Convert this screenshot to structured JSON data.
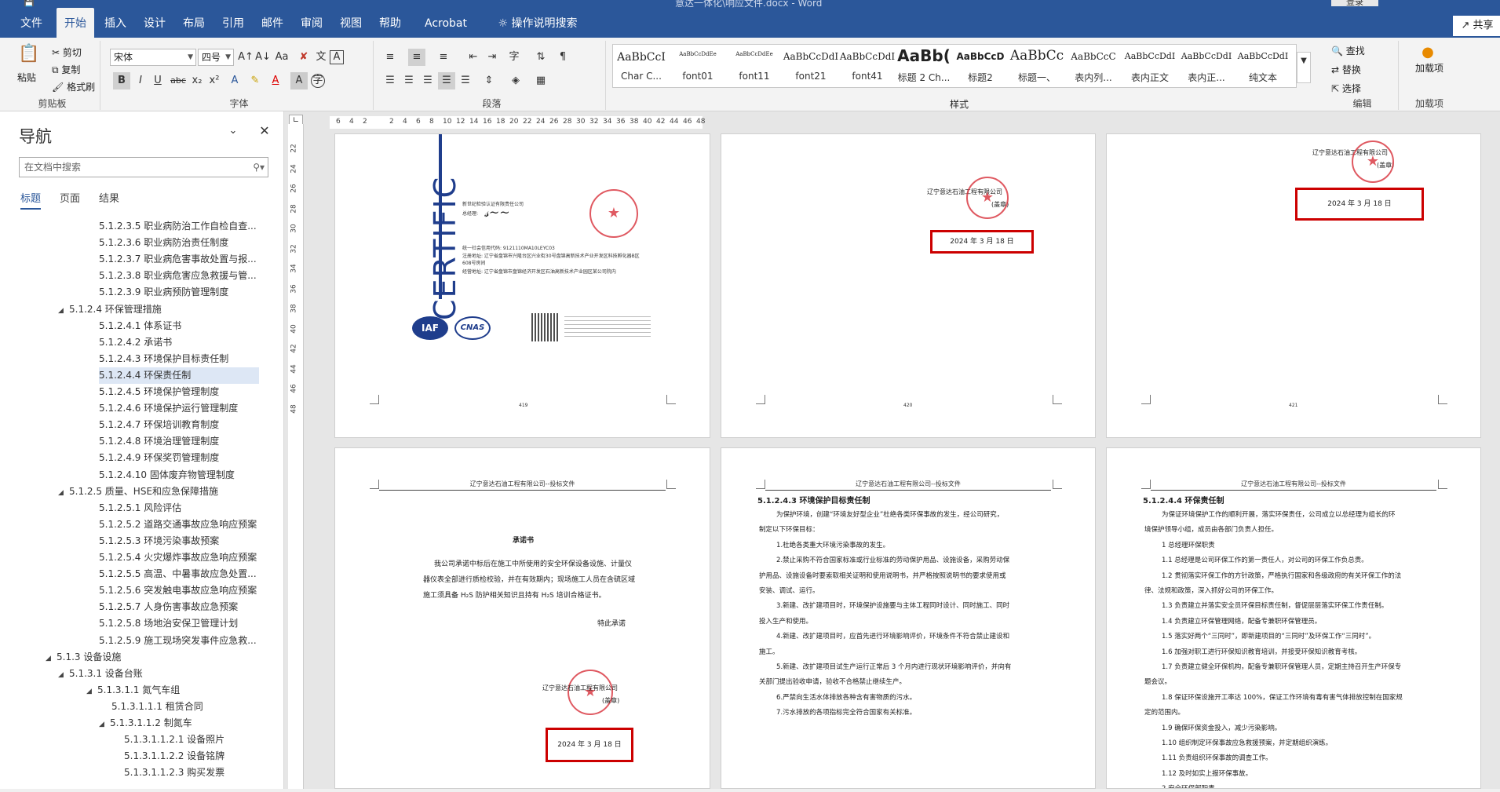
{
  "titlebar": {
    "document_title": "意达一体化\\响应文件.docx  -  Word",
    "login": "登录"
  },
  "menu": {
    "tabs": [
      "文件",
      "开始",
      "插入",
      "设计",
      "布局",
      "引用",
      "邮件",
      "审阅",
      "视图",
      "帮助",
      "Acrobat"
    ],
    "tellme": "操作说明搜索",
    "share": "共享"
  },
  "ribbon": {
    "clipboard": {
      "paste": "粘贴",
      "cut": "剪切",
      "copy": "复制",
      "format_painter": "格式刷",
      "label": "剪贴板"
    },
    "font": {
      "family": "宋体",
      "size": "四号",
      "label": "字体"
    },
    "paragraph": {
      "label": "段落"
    },
    "styles": {
      "label": "样式",
      "items": [
        {
          "preview": "AaBbCcI",
          "name": "Char C..."
        },
        {
          "preview": "AaBbCcDdEe",
          "name": "font01"
        },
        {
          "preview": "AaBbCcDdEe",
          "name": "font11"
        },
        {
          "preview": "AaBbCcDdI",
          "name": "font21"
        },
        {
          "preview": "AaBbCcDdI",
          "name": "font41"
        },
        {
          "preview": "AaBb(",
          "name": "标题 2 Ch..."
        },
        {
          "preview": "AaBbCcD",
          "name": "标题2"
        },
        {
          "preview": "AaBbCc",
          "name": "标题一、"
        },
        {
          "preview": "AaBbCcC",
          "name": "表内列..."
        },
        {
          "preview": "AaBbCcDdI",
          "name": "表内正文"
        },
        {
          "preview": "AaBbCcDdI",
          "name": "表内正..."
        },
        {
          "preview": "AaBbCcDdI",
          "name": "纯文本"
        }
      ]
    },
    "editing": {
      "find": "查找",
      "replace": "替换",
      "select": "选择",
      "label": "编辑"
    },
    "addins": {
      "load": "加载项",
      "label": "加载项"
    }
  },
  "nav": {
    "title": "导航",
    "search_placeholder": "在文档中搜索",
    "tabs": [
      "标题",
      "页面",
      "结果"
    ],
    "items": [
      {
        "level": 3,
        "text": "5.1.2.3.5 职业病防治工作自检自查..."
      },
      {
        "level": 3,
        "text": "5.1.2.3.6 职业病防治责任制度"
      },
      {
        "level": 3,
        "text": "5.1.2.3.7 职业病危害事故处置与报..."
      },
      {
        "level": 3,
        "text": "5.1.2.3.8 职业病危害应急救援与管..."
      },
      {
        "level": 3,
        "text": "5.1.2.3.9 职业病预防管理制度"
      },
      {
        "level": 2,
        "text": "5.1.2.4 环保管理措施",
        "expanded": true
      },
      {
        "level": 3,
        "text": "5.1.2.4.1 体系证书"
      },
      {
        "level": 3,
        "text": "5.1.2.4.2 承诺书"
      },
      {
        "level": 3,
        "text": "5.1.2.4.3 环境保护目标责任制"
      },
      {
        "level": 3,
        "text": "5.1.2.4.4 环保责任制",
        "selected": true
      },
      {
        "level": 3,
        "text": "5.1.2.4.5 环境保护管理制度"
      },
      {
        "level": 3,
        "text": "5.1.2.4.6 环境保护运行管理制度"
      },
      {
        "level": 3,
        "text": "5.1.2.4.7 环保培训教育制度"
      },
      {
        "level": 3,
        "text": "5.1.2.4.8 环境治理管理制度"
      },
      {
        "level": 3,
        "text": "5.1.2.4.9 环保奖罚管理制度"
      },
      {
        "level": 3,
        "text": "5.1.2.4.10 固体废弃物管理制度"
      },
      {
        "level": 2,
        "text": "5.1.2.5 质量、HSE和应急保障措施",
        "expanded": true
      },
      {
        "level": 3,
        "text": "5.1.2.5.1 风险评估"
      },
      {
        "level": 3,
        "text": "5.1.2.5.2 道路交通事故应急响应预案"
      },
      {
        "level": 3,
        "text": "5.1.2.5.3 环境污染事故预案"
      },
      {
        "level": 3,
        "text": "5.1.2.5.4 火灾爆炸事故应急响应预案"
      },
      {
        "level": 3,
        "text": "5.1.2.5.5 高温、中暑事故应急处置..."
      },
      {
        "level": 3,
        "text": "5.1.2.5.6 突发触电事故应急响应预案"
      },
      {
        "level": 3,
        "text": "5.1.2.5.7 人身伤害事故应急预案"
      },
      {
        "level": 3,
        "text": "5.1.2.5.8 场地治安保卫管理计划"
      },
      {
        "level": 3,
        "text": "5.1.2.5.9 施工现场突发事件应急救..."
      },
      {
        "level": 1,
        "text": "5.1.3 设备设施",
        "expanded": true
      },
      {
        "level": 2,
        "text": "5.1.3.1 设备台账",
        "expanded": true
      },
      {
        "level": 3,
        "text": "5.1.3.1.1 氮气车组",
        "expanded": true
      },
      {
        "level": 4,
        "text": "5.1.3.1.1.1 租赁合同"
      },
      {
        "level": 4,
        "text": "5.1.3.1.1.2 制氮车",
        "expanded": true
      },
      {
        "level": 5,
        "text": "5.1.3.1.1.2.1 设备照片"
      },
      {
        "level": 5,
        "text": "5.1.3.1.1.2.2 设备铭牌"
      },
      {
        "level": 5,
        "text": "5.1.3.1.1.2.3 购买发票"
      }
    ]
  },
  "ruler": {
    "h_ticks": [
      "6",
      "4",
      "2",
      "",
      "2",
      "4",
      "6",
      "8",
      "10",
      "12",
      "14",
      "16",
      "18",
      "20",
      "22",
      "24",
      "26",
      "28",
      "30",
      "32",
      "34",
      "36",
      "38",
      "40",
      "42",
      "44",
      "46",
      "48"
    ],
    "v_ticks": [
      "22",
      "24",
      "26",
      "28",
      "30",
      "32",
      "34",
      "36",
      "38",
      "40",
      "42",
      "44",
      "46",
      "48"
    ]
  },
  "pages": {
    "p1": {
      "cert_word": "CERTIFIC",
      "org": "新世纪检验认证有限责任公司",
      "gm": "总经理:",
      "lines": [
        "统一社会信用代码: 9121110MA10LEYC03",
        "注册地址: 辽宁省盘锦市兴隆台区兴业街30号盘锦高新技术产业开发区科技孵化器B区608号房间",
        "经营地址: 辽宁省盘锦市盘锦经济开发区石油高新技术产业园区某公司院内"
      ],
      "iaf": "IAF",
      "cnas": "CNAS",
      "page_num": "419"
    },
    "p2": {
      "company": "辽宁意达石油工程有限公司",
      "seal": "(盖章)",
      "date": "2024 年 3 月 18 日",
      "page_num": "420"
    },
    "p3": {
      "company": "辽宁意达石油工程有限公司",
      "seal": "(盖章)",
      "date": "2024 年 3 月 18 日",
      "page_num": "421"
    },
    "p4": {
      "header": "辽宁意达石油工程有限公司--投标文件",
      "title": "承诺书",
      "body": [
        "我公司承诺中标后在施工中所使用的安全环保设备设施、计量仪",
        "器仪表全部进行质检校验，并在有效期内；现场施工人员在含硫区域",
        "施工须具备 H₂S 防护相关知识且持有 H₂S 培训合格证书。"
      ],
      "sign": "特此承诺",
      "company": "辽宁意达石油工程有限公司",
      "seal": "(盖章)",
      "date": "2024 年 3 月 18 日"
    },
    "p5": {
      "header": "辽宁意达石油工程有限公司--投标文件",
      "title": "5.1.2.4.3 环境保护目标责任制",
      "lines": [
        "为保护环境，创建“环境友好型企业”杜绝各类环保事故的发生，经公司研究，",
        "制定以下环保目标：",
        "1.杜绝各类重大环境污染事故的发生。",
        "2.禁止采购不符合国家标准或行业标准的劳动保护用品、设施设备，采购劳动保",
        "护用品、设施设备时要索取相关证明和使用说明书，并严格按照说明书的要求使用或",
        "安装、调试、运行。",
        "3.新建、改扩建项目时，环境保护设施要与主体工程同时设计、同时施工、同时",
        "投入生产和使用。",
        "4.新建、改扩建项目时，应首先进行环境影响评价，环境条件不符合禁止建设和",
        "施工。",
        "5.新建、改扩建项目试生产运行正常后 3 个月内进行现状环境影响评价，并向有",
        "关部门提出验收申请，验收不合格禁止继续生产。",
        "6.严禁向生活水体排放各种含有害物质的污水。",
        "7.污水排放的各项指标完全符合国家有关标准。"
      ]
    },
    "p6": {
      "header": "辽宁意达石油工程有限公司--投标文件",
      "title": "5.1.2.4.4 环保责任制",
      "lines": [
        "为保证环境保护工作的顺利开展，落实环保责任，公司成立以总经理为组长的环",
        "境保护领导小组，成员由各部门负责人担任。",
        "1 总经理环保职责",
        "1.1 总经理是公司环保工作的第一责任人，对公司的环保工作负总责。",
        "1.2 贯彻落实环保工作的方针政策，严格执行国家和各级政府的有关环保工作的法",
        "律、法规和政策，深入抓好公司的环保工作。",
        "1.3 负责建立并落实安全员环保目标责任制，督促层层落实环保工作责任制。",
        "1.4 负责建立环保管理网络，配备专兼职环保管理员。",
        "1.5 落实好两个“三同时”，即新建项目的“三同时”及环保工作“三同时”。",
        "1.6 加强对职工进行环保知识教育培训，并接受环保知识教育考核。",
        "1.7 负责建立健全环保机构，配备专兼职环保管理人员，定期主持召开生产环保专",
        "题会议。",
        "1.8 保证环保设施开工率达 100%，保证工作环境有毒有害气体排放控制在国家规",
        "定的范围内。",
        "1.9 确保环保资金投入，减少污染影响。",
        "1.10 组织制定环保事故应急救援预案，并定期组织演练。",
        "1.11 负责组织环保事故的调查工作。",
        "1.12 及时如实上报环保事故。",
        "2 安全环保部职责"
      ]
    }
  }
}
